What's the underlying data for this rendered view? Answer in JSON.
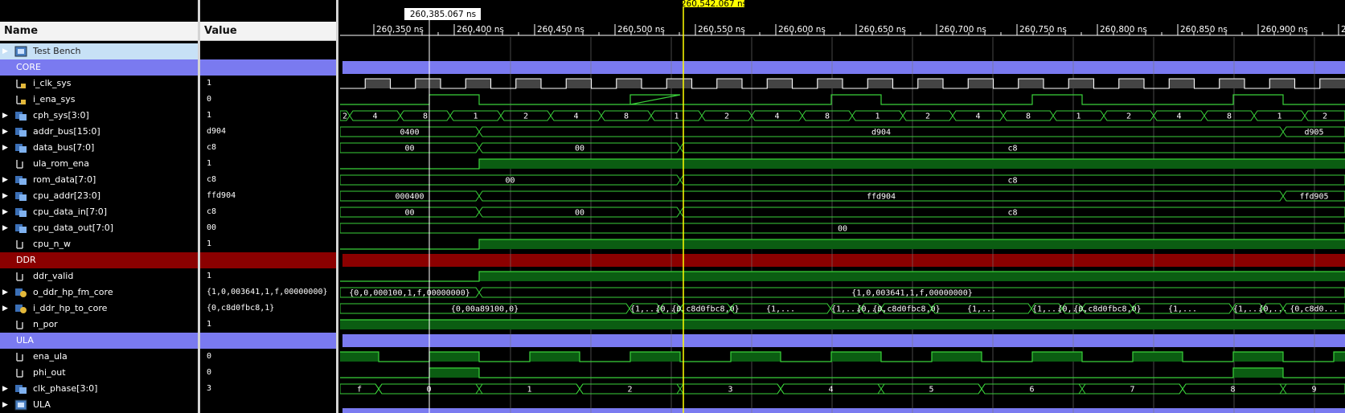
{
  "headers": {
    "name": "Name",
    "value": "Value"
  },
  "rows": [
    {
      "name": "Test Bench",
      "value": "",
      "kind": "tb",
      "expand": true,
      "icon": "testbench-icon"
    },
    {
      "name": "CORE",
      "value": "",
      "kind": "group",
      "color": "#7a7af0"
    },
    {
      "name": "i_clk_sys",
      "value": "1",
      "kind": "bit",
      "icon": "input-bit-icon"
    },
    {
      "name": "i_ena_sys",
      "value": "0",
      "kind": "bit",
      "icon": "input-bit-icon"
    },
    {
      "name": "cph_sys[3:0]",
      "value": "1",
      "kind": "bus",
      "expand": true,
      "icon": "bus-icon"
    },
    {
      "name": "addr_bus[15:0]",
      "value": "d904",
      "kind": "bus",
      "expand": true,
      "icon": "bus-icon"
    },
    {
      "name": "data_bus[7:0]",
      "value": "c8",
      "kind": "bus",
      "expand": true,
      "icon": "bus-icon"
    },
    {
      "name": "ula_rom_ena",
      "value": "1",
      "kind": "bit",
      "icon": "bit-icon"
    },
    {
      "name": "rom_data[7:0]",
      "value": "c8",
      "kind": "bus",
      "expand": true,
      "icon": "bus-icon"
    },
    {
      "name": "cpu_addr[23:0]",
      "value": "ffd904",
      "kind": "bus",
      "expand": true,
      "icon": "bus-icon"
    },
    {
      "name": "cpu_data_in[7:0]",
      "value": "c8",
      "kind": "bus",
      "expand": true,
      "icon": "bus-icon"
    },
    {
      "name": "cpu_data_out[7:0]",
      "value": "00",
      "kind": "bus",
      "expand": true,
      "icon": "bus-icon"
    },
    {
      "name": "cpu_n_w",
      "value": "1",
      "kind": "bit",
      "icon": "bit-icon"
    },
    {
      "name": "DDR",
      "value": "",
      "kind": "group",
      "color": "#8b0000"
    },
    {
      "name": "ddr_valid",
      "value": "1",
      "kind": "bit",
      "icon": "bit-icon"
    },
    {
      "name": "o_ddr_hp_fm_core",
      "value": "{1,0,003641,1,f,00000000}",
      "kind": "bus",
      "expand": true,
      "icon": "record-icon"
    },
    {
      "name": "i_ddr_hp_to_core",
      "value": "{0,c8d0fbc8,1}",
      "kind": "bus",
      "expand": true,
      "icon": "record-icon"
    },
    {
      "name": "n_por",
      "value": "1",
      "kind": "bit",
      "icon": "bit-icon"
    },
    {
      "name": "ULA",
      "value": "",
      "kind": "group",
      "color": "#7a7af0"
    },
    {
      "name": "ena_ula",
      "value": "0",
      "kind": "bit",
      "icon": "bit-icon"
    },
    {
      "name": "phi_out",
      "value": "0",
      "kind": "bit",
      "icon": "bit-icon"
    },
    {
      "name": "clk_phase[3:0]",
      "value": "3",
      "kind": "bus",
      "expand": true,
      "icon": "bus-icon"
    },
    {
      "name": "ULA",
      "value": "",
      "kind": "scope",
      "expand": true,
      "icon": "scope-icon"
    }
  ],
  "time_axis": {
    "ticks": [
      "260,350 ns",
      "260,400 ns",
      "260,450 ns",
      "260,500 ns",
      "260,550 ns",
      "260,600 ns",
      "260,650 ns",
      "260,700 ns",
      "260,750 ns",
      "260,800 ns",
      "260,850 ns",
      "260,900 ns",
      "2"
    ],
    "marker_label": "260,385.067 ns",
    "cursor_label": "260,542.067 ns",
    "cursor_color": "#ffff00"
  },
  "bus_labels": {
    "cph_sys": [
      "2",
      "4",
      "8",
      "1",
      "2",
      "4",
      "8",
      "1",
      "2",
      "4",
      "8",
      "1",
      "2",
      "4",
      "8",
      "1",
      "2",
      "4",
      "8",
      "1",
      "2"
    ],
    "addr_bus": [
      "0400",
      "d904",
      "d905"
    ],
    "data_bus": [
      "00",
      "00",
      "c8"
    ],
    "rom_data": [
      "00",
      "c8"
    ],
    "cpu_addr": [
      "000400",
      "ffd904",
      "ffd905"
    ],
    "cpu_data_in": [
      "00",
      "00",
      "c8"
    ],
    "cpu_data_out": [
      "00"
    ],
    "o_ddr": [
      "{0,0,000100,1,f,00000000}",
      "{1,0,003641,1,f,00000000}"
    ],
    "i_ddr": [
      "{0,00a89100,0}",
      "{1,...",
      "{0,...",
      "{0,c8d0fbc8,0}",
      "{1,...",
      "{1,...",
      "{0,...",
      "{0,c8d0fbc8,0}",
      "{1,...",
      "{1,...",
      "{0,...",
      "{0,c8d0fbc8,0}",
      "{1,...",
      "{1,...",
      "{0,...",
      "{0,c8d0..."
    ],
    "clk_phase": [
      "f",
      "0",
      "1",
      "2",
      "3",
      "4",
      "5",
      "6",
      "7",
      "8",
      "9"
    ]
  },
  "colors": {
    "wave": "#3ad13a",
    "fill": "#0b5d12",
    "group_blue": "#7a7af0",
    "group_red": "#8b0000"
  }
}
